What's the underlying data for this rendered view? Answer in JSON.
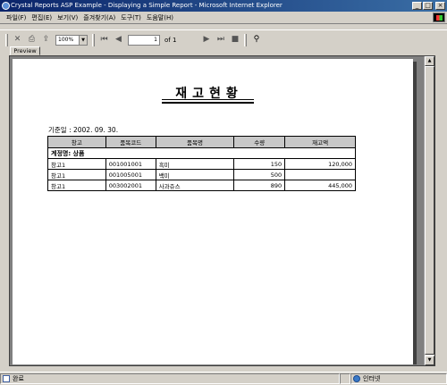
{
  "window": {
    "title": "Crystal Reports ASP Example - Displaying a Simple Report - Microsoft Internet Explorer",
    "minimize": "_",
    "maximize": "□",
    "close": "×"
  },
  "menu": [
    "파일(F)",
    "편집(E)",
    "보기(V)",
    "즐겨찾기(A)",
    "도구(T)",
    "도움말(H)"
  ],
  "toolbar": {
    "zoom": "100%",
    "page_current": "1",
    "page_total_label": "of 1",
    "zoom_arrow": "▼"
  },
  "tab": {
    "label": "Preview"
  },
  "report": {
    "title": "재고현황",
    "base_date": "기준일 : 2002. 09. 30.",
    "columns": [
      "창고",
      "품목코드",
      "품목명",
      "수량",
      "재고액"
    ],
    "group_label": "계정명: 상품",
    "rows": [
      {
        "warehouse": "창고1",
        "code": "001001001",
        "name": "흑미",
        "qty": "150",
        "amount": "120,000"
      },
      {
        "warehouse": "창고1",
        "code": "001005001",
        "name": "백미",
        "qty": "500",
        "amount": ""
      },
      {
        "warehouse": "창고1",
        "code": "003002001",
        "name": "사과쥬스",
        "qty": "890",
        "amount": "445,000"
      }
    ]
  },
  "status": {
    "left": "완료",
    "zone": "인터넷"
  }
}
